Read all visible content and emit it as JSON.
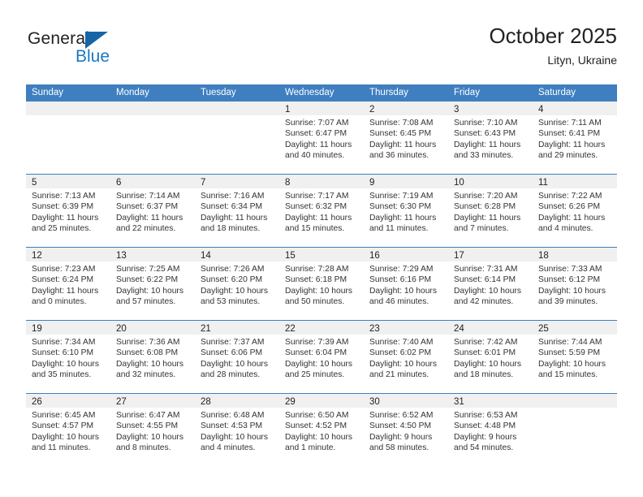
{
  "brand": {
    "name_top": "General",
    "name_bottom": "Blue",
    "accent_color": "#1a78c2",
    "triangle_color": "#1565a8",
    "logo_icon": "general-blue-logo"
  },
  "header": {
    "title": "October 2025",
    "subtitle": "Lityn, Ukraine"
  },
  "theme": {
    "header_row_bg": "#3f7fc0",
    "header_row_text": "#ffffff",
    "day_band_bg": "#f0f0f0",
    "row_divider": "#3f7fc0",
    "body_text": "#333333"
  },
  "calendar": {
    "weekdays": [
      "Sunday",
      "Monday",
      "Tuesday",
      "Wednesday",
      "Thursday",
      "Friday",
      "Saturday"
    ],
    "weeks": [
      [
        {
          "day": "",
          "lines": []
        },
        {
          "day": "",
          "lines": []
        },
        {
          "day": "",
          "lines": []
        },
        {
          "day": "1",
          "lines": [
            "Sunrise: 7:07 AM",
            "Sunset: 6:47 PM",
            "Daylight: 11 hours",
            "and 40 minutes."
          ]
        },
        {
          "day": "2",
          "lines": [
            "Sunrise: 7:08 AM",
            "Sunset: 6:45 PM",
            "Daylight: 11 hours",
            "and 36 minutes."
          ]
        },
        {
          "day": "3",
          "lines": [
            "Sunrise: 7:10 AM",
            "Sunset: 6:43 PM",
            "Daylight: 11 hours",
            "and 33 minutes."
          ]
        },
        {
          "day": "4",
          "lines": [
            "Sunrise: 7:11 AM",
            "Sunset: 6:41 PM",
            "Daylight: 11 hours",
            "and 29 minutes."
          ]
        }
      ],
      [
        {
          "day": "5",
          "lines": [
            "Sunrise: 7:13 AM",
            "Sunset: 6:39 PM",
            "Daylight: 11 hours",
            "and 25 minutes."
          ]
        },
        {
          "day": "6",
          "lines": [
            "Sunrise: 7:14 AM",
            "Sunset: 6:37 PM",
            "Daylight: 11 hours",
            "and 22 minutes."
          ]
        },
        {
          "day": "7",
          "lines": [
            "Sunrise: 7:16 AM",
            "Sunset: 6:34 PM",
            "Daylight: 11 hours",
            "and 18 minutes."
          ]
        },
        {
          "day": "8",
          "lines": [
            "Sunrise: 7:17 AM",
            "Sunset: 6:32 PM",
            "Daylight: 11 hours",
            "and 15 minutes."
          ]
        },
        {
          "day": "9",
          "lines": [
            "Sunrise: 7:19 AM",
            "Sunset: 6:30 PM",
            "Daylight: 11 hours",
            "and 11 minutes."
          ]
        },
        {
          "day": "10",
          "lines": [
            "Sunrise: 7:20 AM",
            "Sunset: 6:28 PM",
            "Daylight: 11 hours",
            "and 7 minutes."
          ]
        },
        {
          "day": "11",
          "lines": [
            "Sunrise: 7:22 AM",
            "Sunset: 6:26 PM",
            "Daylight: 11 hours",
            "and 4 minutes."
          ]
        }
      ],
      [
        {
          "day": "12",
          "lines": [
            "Sunrise: 7:23 AM",
            "Sunset: 6:24 PM",
            "Daylight: 11 hours",
            "and 0 minutes."
          ]
        },
        {
          "day": "13",
          "lines": [
            "Sunrise: 7:25 AM",
            "Sunset: 6:22 PM",
            "Daylight: 10 hours",
            "and 57 minutes."
          ]
        },
        {
          "day": "14",
          "lines": [
            "Sunrise: 7:26 AM",
            "Sunset: 6:20 PM",
            "Daylight: 10 hours",
            "and 53 minutes."
          ]
        },
        {
          "day": "15",
          "lines": [
            "Sunrise: 7:28 AM",
            "Sunset: 6:18 PM",
            "Daylight: 10 hours",
            "and 50 minutes."
          ]
        },
        {
          "day": "16",
          "lines": [
            "Sunrise: 7:29 AM",
            "Sunset: 6:16 PM",
            "Daylight: 10 hours",
            "and 46 minutes."
          ]
        },
        {
          "day": "17",
          "lines": [
            "Sunrise: 7:31 AM",
            "Sunset: 6:14 PM",
            "Daylight: 10 hours",
            "and 42 minutes."
          ]
        },
        {
          "day": "18",
          "lines": [
            "Sunrise: 7:33 AM",
            "Sunset: 6:12 PM",
            "Daylight: 10 hours",
            "and 39 minutes."
          ]
        }
      ],
      [
        {
          "day": "19",
          "lines": [
            "Sunrise: 7:34 AM",
            "Sunset: 6:10 PM",
            "Daylight: 10 hours",
            "and 35 minutes."
          ]
        },
        {
          "day": "20",
          "lines": [
            "Sunrise: 7:36 AM",
            "Sunset: 6:08 PM",
            "Daylight: 10 hours",
            "and 32 minutes."
          ]
        },
        {
          "day": "21",
          "lines": [
            "Sunrise: 7:37 AM",
            "Sunset: 6:06 PM",
            "Daylight: 10 hours",
            "and 28 minutes."
          ]
        },
        {
          "day": "22",
          "lines": [
            "Sunrise: 7:39 AM",
            "Sunset: 6:04 PM",
            "Daylight: 10 hours",
            "and 25 minutes."
          ]
        },
        {
          "day": "23",
          "lines": [
            "Sunrise: 7:40 AM",
            "Sunset: 6:02 PM",
            "Daylight: 10 hours",
            "and 21 minutes."
          ]
        },
        {
          "day": "24",
          "lines": [
            "Sunrise: 7:42 AM",
            "Sunset: 6:01 PM",
            "Daylight: 10 hours",
            "and 18 minutes."
          ]
        },
        {
          "day": "25",
          "lines": [
            "Sunrise: 7:44 AM",
            "Sunset: 5:59 PM",
            "Daylight: 10 hours",
            "and 15 minutes."
          ]
        }
      ],
      [
        {
          "day": "26",
          "lines": [
            "Sunrise: 6:45 AM",
            "Sunset: 4:57 PM",
            "Daylight: 10 hours",
            "and 11 minutes."
          ]
        },
        {
          "day": "27",
          "lines": [
            "Sunrise: 6:47 AM",
            "Sunset: 4:55 PM",
            "Daylight: 10 hours",
            "and 8 minutes."
          ]
        },
        {
          "day": "28",
          "lines": [
            "Sunrise: 6:48 AM",
            "Sunset: 4:53 PM",
            "Daylight: 10 hours",
            "and 4 minutes."
          ]
        },
        {
          "day": "29",
          "lines": [
            "Sunrise: 6:50 AM",
            "Sunset: 4:52 PM",
            "Daylight: 10 hours",
            "and 1 minute."
          ]
        },
        {
          "day": "30",
          "lines": [
            "Sunrise: 6:52 AM",
            "Sunset: 4:50 PM",
            "Daylight: 9 hours",
            "and 58 minutes."
          ]
        },
        {
          "day": "31",
          "lines": [
            "Sunrise: 6:53 AM",
            "Sunset: 4:48 PM",
            "Daylight: 9 hours",
            "and 54 minutes."
          ]
        },
        {
          "day": "",
          "lines": []
        }
      ]
    ]
  }
}
